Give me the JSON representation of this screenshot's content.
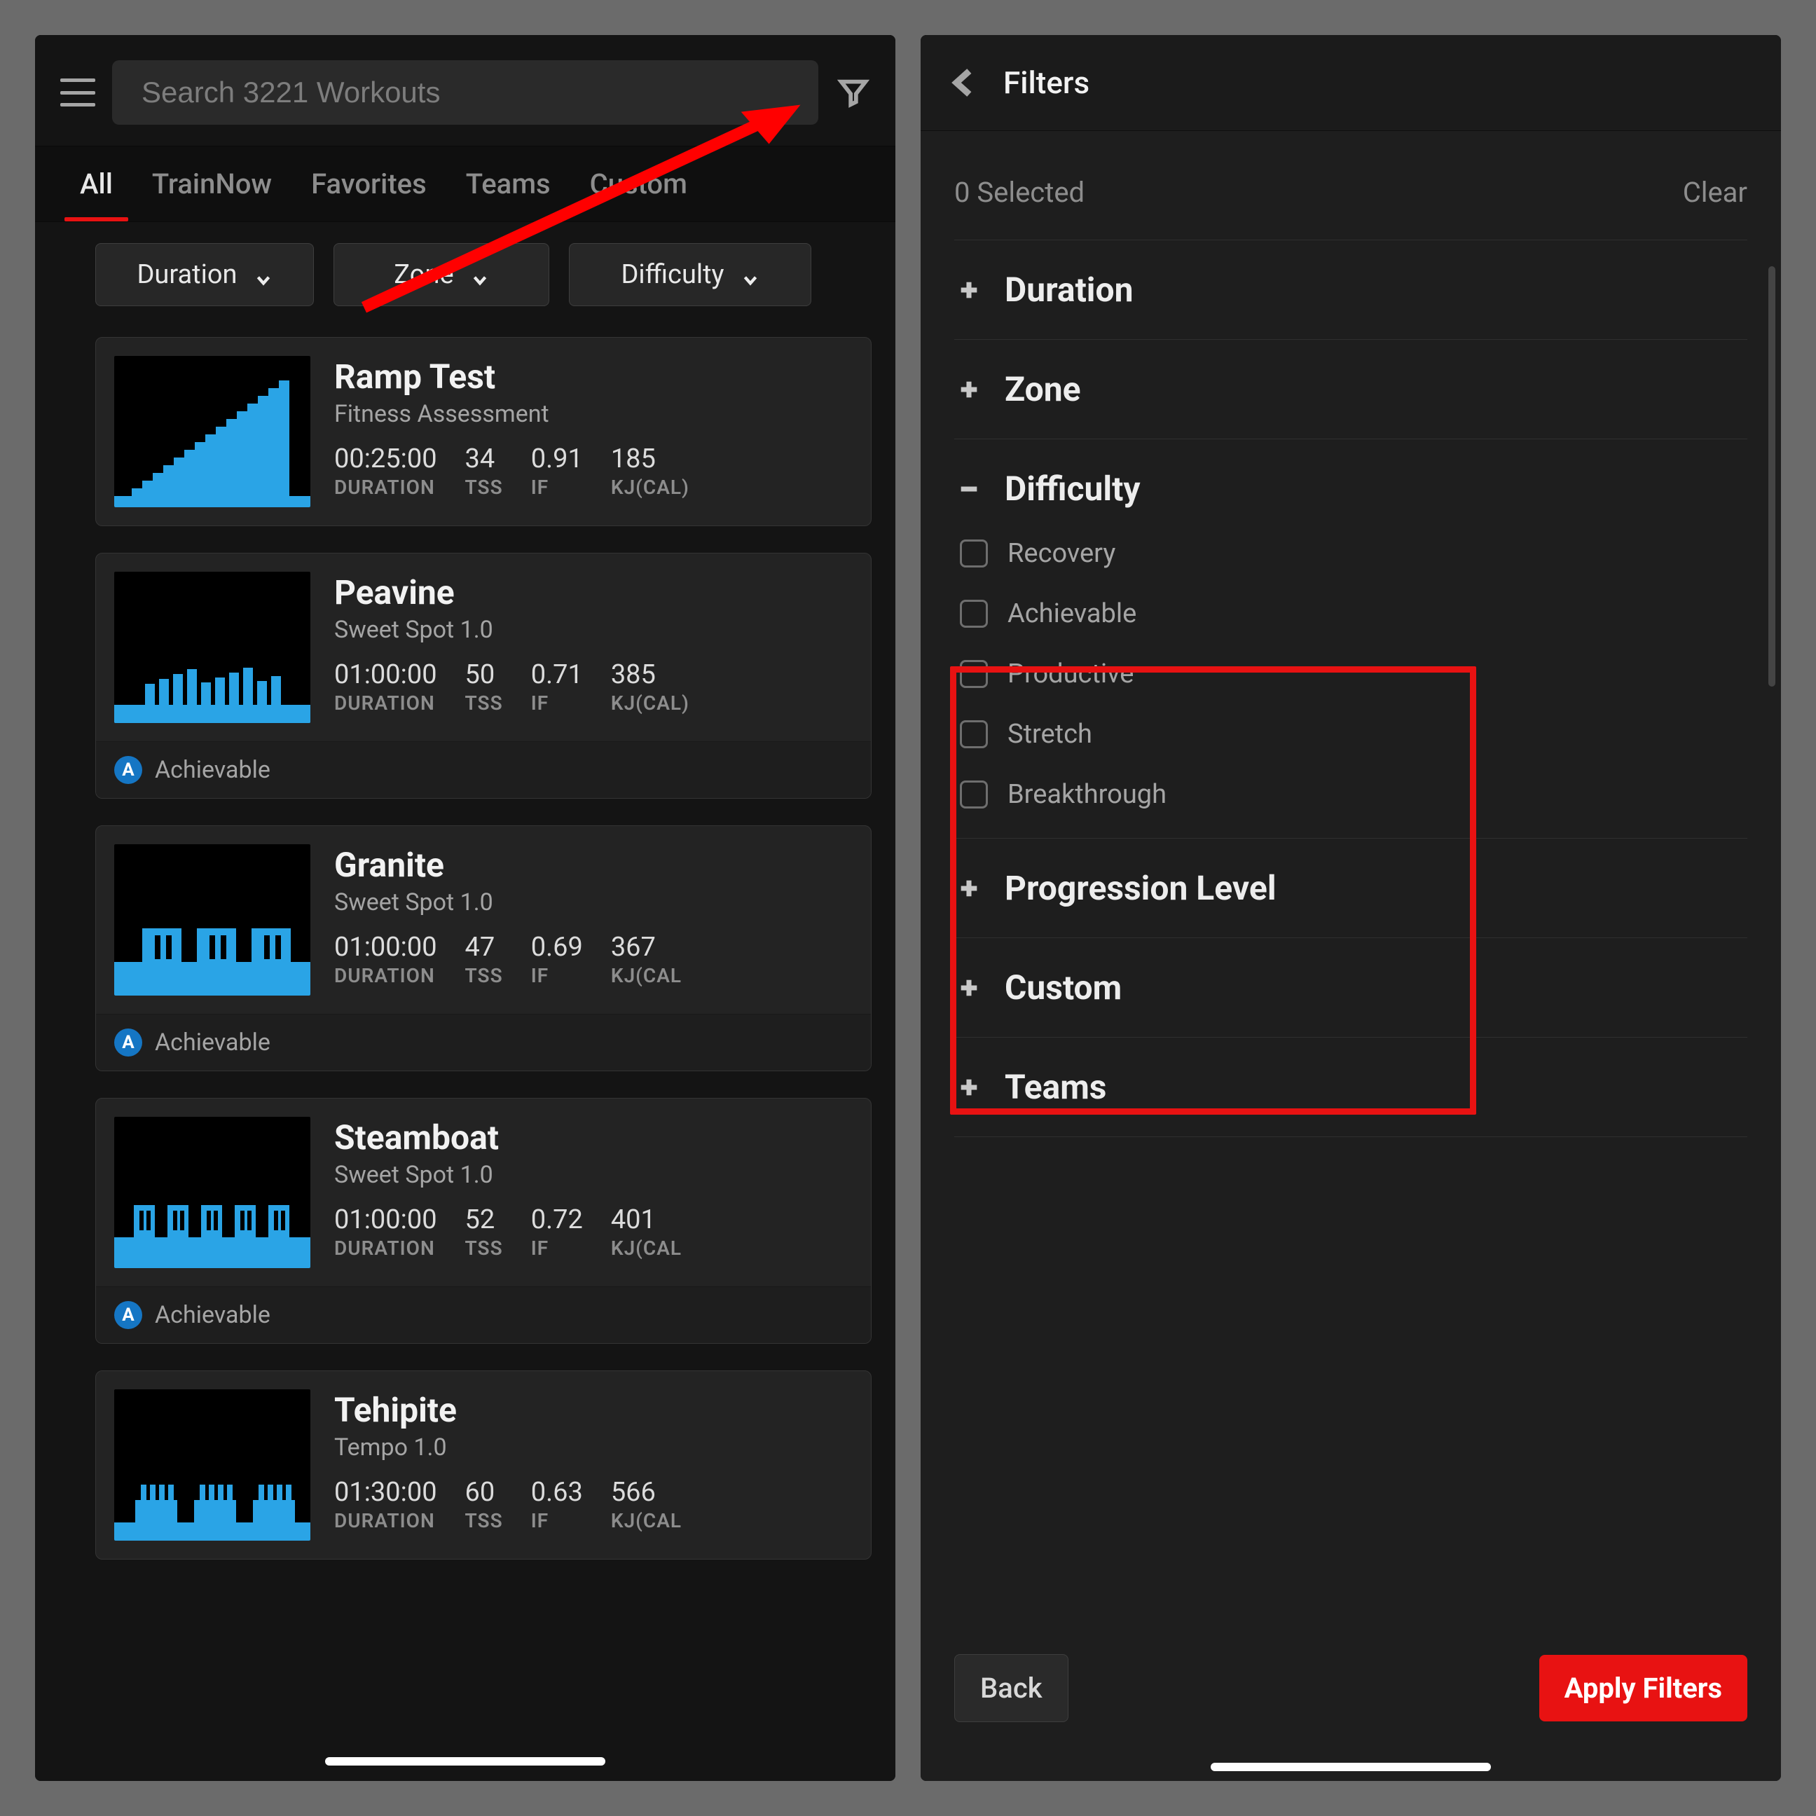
{
  "left": {
    "search": {
      "placeholder": "Search 3221 Workouts"
    },
    "tabs": [
      "All",
      "TrainNow",
      "Favorites",
      "Teams",
      "Custom"
    ],
    "active_tab": 0,
    "quick": {
      "duration": "Duration",
      "zone": "Zone",
      "difficulty": "Difficulty"
    },
    "workouts": [
      {
        "title": "Ramp Test",
        "subtitle": "Fitness Assessment",
        "stats": [
          {
            "val": "00:25:00",
            "lbl": "DURATION"
          },
          {
            "val": "34",
            "lbl": "TSS"
          },
          {
            "val": "0.91",
            "lbl": "IF"
          },
          {
            "val": "185",
            "lbl": "KJ(CAL)"
          }
        ],
        "badge": null,
        "thumb": "ramp"
      },
      {
        "title": "Peavine",
        "subtitle": "Sweet Spot 1.0",
        "stats": [
          {
            "val": "01:00:00",
            "lbl": "DURATION"
          },
          {
            "val": "50",
            "lbl": "TSS"
          },
          {
            "val": "0.71",
            "lbl": "IF"
          },
          {
            "val": "385",
            "lbl": "KJ(CAL)"
          }
        ],
        "badge": {
          "letter": "A",
          "text": "Achievable"
        },
        "thumb": "intervals1"
      },
      {
        "title": "Granite",
        "subtitle": "Sweet Spot 1.0",
        "stats": [
          {
            "val": "01:00:00",
            "lbl": "DURATION"
          },
          {
            "val": "47",
            "lbl": "TSS"
          },
          {
            "val": "0.69",
            "lbl": "IF"
          },
          {
            "val": "367",
            "lbl": "KJ(CAL"
          }
        ],
        "badge": {
          "letter": "A",
          "text": "Achievable"
        },
        "thumb": "intervals2"
      },
      {
        "title": "Steamboat",
        "subtitle": "Sweet Spot 1.0",
        "stats": [
          {
            "val": "01:00:00",
            "lbl": "DURATION"
          },
          {
            "val": "52",
            "lbl": "TSS"
          },
          {
            "val": "0.72",
            "lbl": "IF"
          },
          {
            "val": "401",
            "lbl": "KJ(CAL"
          }
        ],
        "badge": {
          "letter": "A",
          "text": "Achievable"
        },
        "thumb": "intervals3"
      },
      {
        "title": "Tehipite",
        "subtitle": "Tempo 1.0",
        "stats": [
          {
            "val": "01:30:00",
            "lbl": "DURATION"
          },
          {
            "val": "60",
            "lbl": "TSS"
          },
          {
            "val": "0.63",
            "lbl": "IF"
          },
          {
            "val": "566",
            "lbl": "KJ(CAL"
          }
        ],
        "badge": null,
        "thumb": "intervals4"
      }
    ]
  },
  "right": {
    "title": "Filters",
    "selected": "0 Selected",
    "clear": "Clear",
    "sections": [
      {
        "label": "Duration",
        "open": false
      },
      {
        "label": "Zone",
        "open": false
      },
      {
        "label": "Difficulty",
        "open": true,
        "options": [
          "Recovery",
          "Achievable",
          "Productive",
          "Stretch",
          "Breakthrough"
        ]
      },
      {
        "label": "Progression Level",
        "open": false
      },
      {
        "label": "Custom",
        "open": false
      },
      {
        "label": "Teams",
        "open": false
      }
    ],
    "back_btn": "Back",
    "apply_btn": "Apply Filters"
  }
}
